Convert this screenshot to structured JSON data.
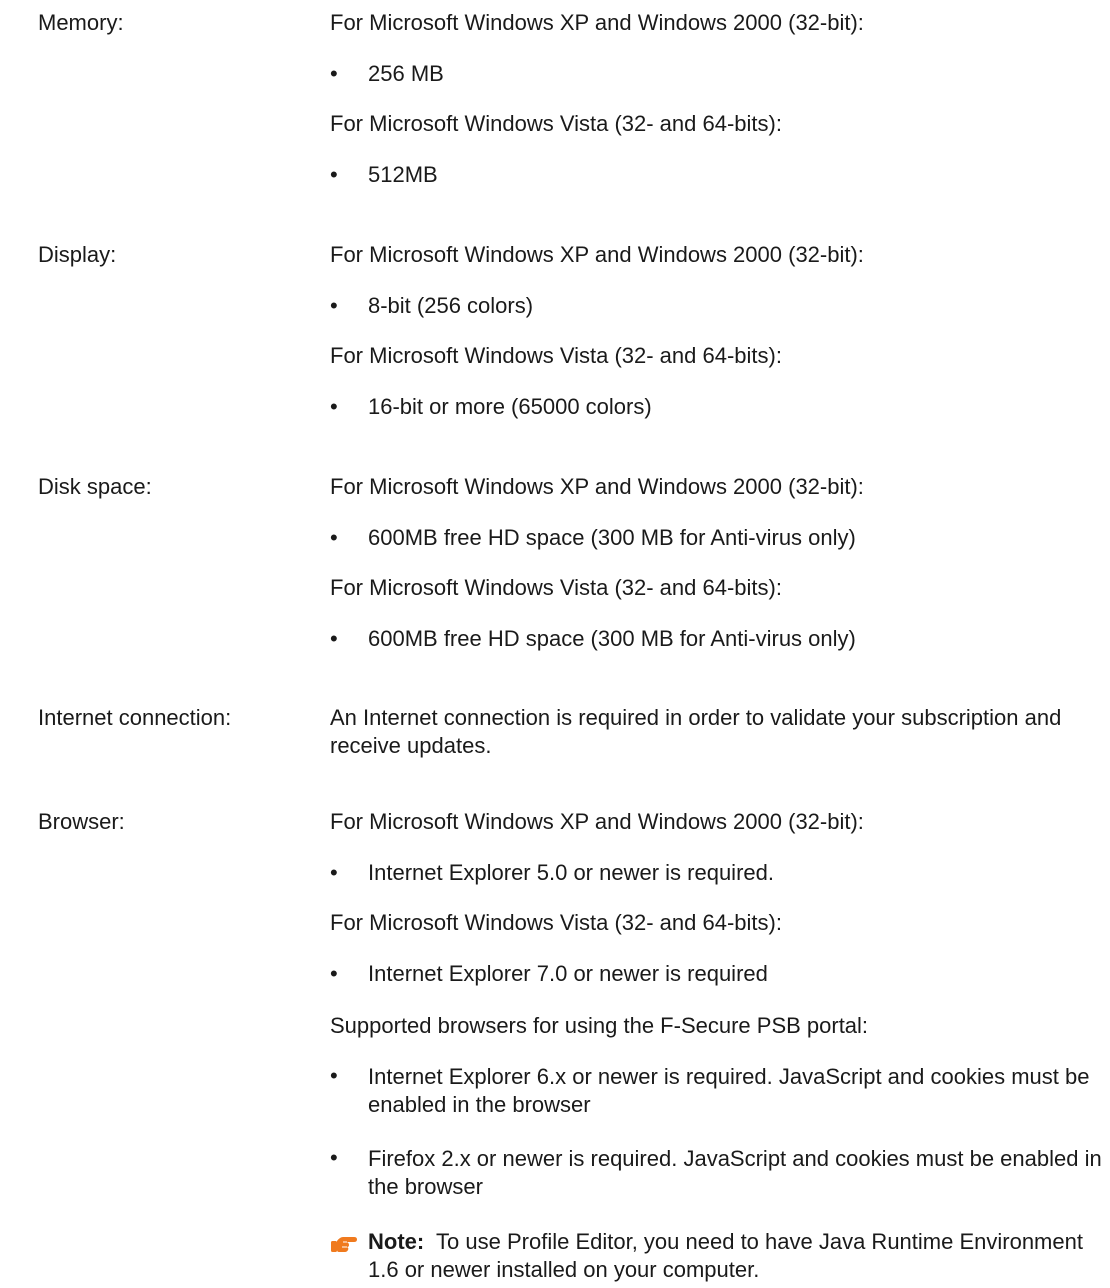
{
  "sections": {
    "memory": {
      "label": "Memory:",
      "h1": "For Microsoft Windows XP and Windows 2000 (32-bit):",
      "b1": "256 MB",
      "h2": "For Microsoft Windows Vista (32- and 64-bits):",
      "b2": "512MB"
    },
    "display": {
      "label": "Display:",
      "h1": "For Microsoft Windows XP and Windows 2000 (32-bit):",
      "b1": "8-bit (256 colors)",
      "h2": "For Microsoft Windows Vista (32- and 64-bits):",
      "b2": "16-bit or more (65000 colors)"
    },
    "disk": {
      "label": "Disk space:",
      "h1": "For Microsoft Windows XP and Windows 2000 (32-bit):",
      "b1": "600MB free HD space (300 MB for Anti-virus only)",
      "h2": "For Microsoft Windows Vista (32- and 64-bits):",
      "b2": "600MB free HD space (300 MB for Anti-virus only)"
    },
    "internet": {
      "label": "Internet connection:",
      "text": "An Internet connection is required in order to validate your subscription and receive updates."
    },
    "browser": {
      "label": "Browser:",
      "h1": "For Microsoft Windows XP and Windows 2000 (32-bit):",
      "b1": "Internet Explorer 5.0 or newer is required.",
      "h2": "For Microsoft Windows Vista (32- and 64-bits):",
      "b2": "Internet Explorer 7.0 or newer is required",
      "h3": "Supported browsers for using the F-Secure PSB portal:",
      "b3": "Internet Explorer 6.x or newer is required. JavaScript and cookies must be enabled in the browser",
      "b4": "Firefox 2.x or newer is required. JavaScript and cookies must be enabled in the browser"
    }
  },
  "note": {
    "label": "Note:",
    "text": "To use Profile Editor, you need to have Java Runtime Environment 1.6 or newer installed on your computer.",
    "icon": "pointing-hand-icon"
  },
  "bullet_char": "•",
  "colors": {
    "text": "#1a1a1a",
    "icon": "#f07a1e"
  }
}
